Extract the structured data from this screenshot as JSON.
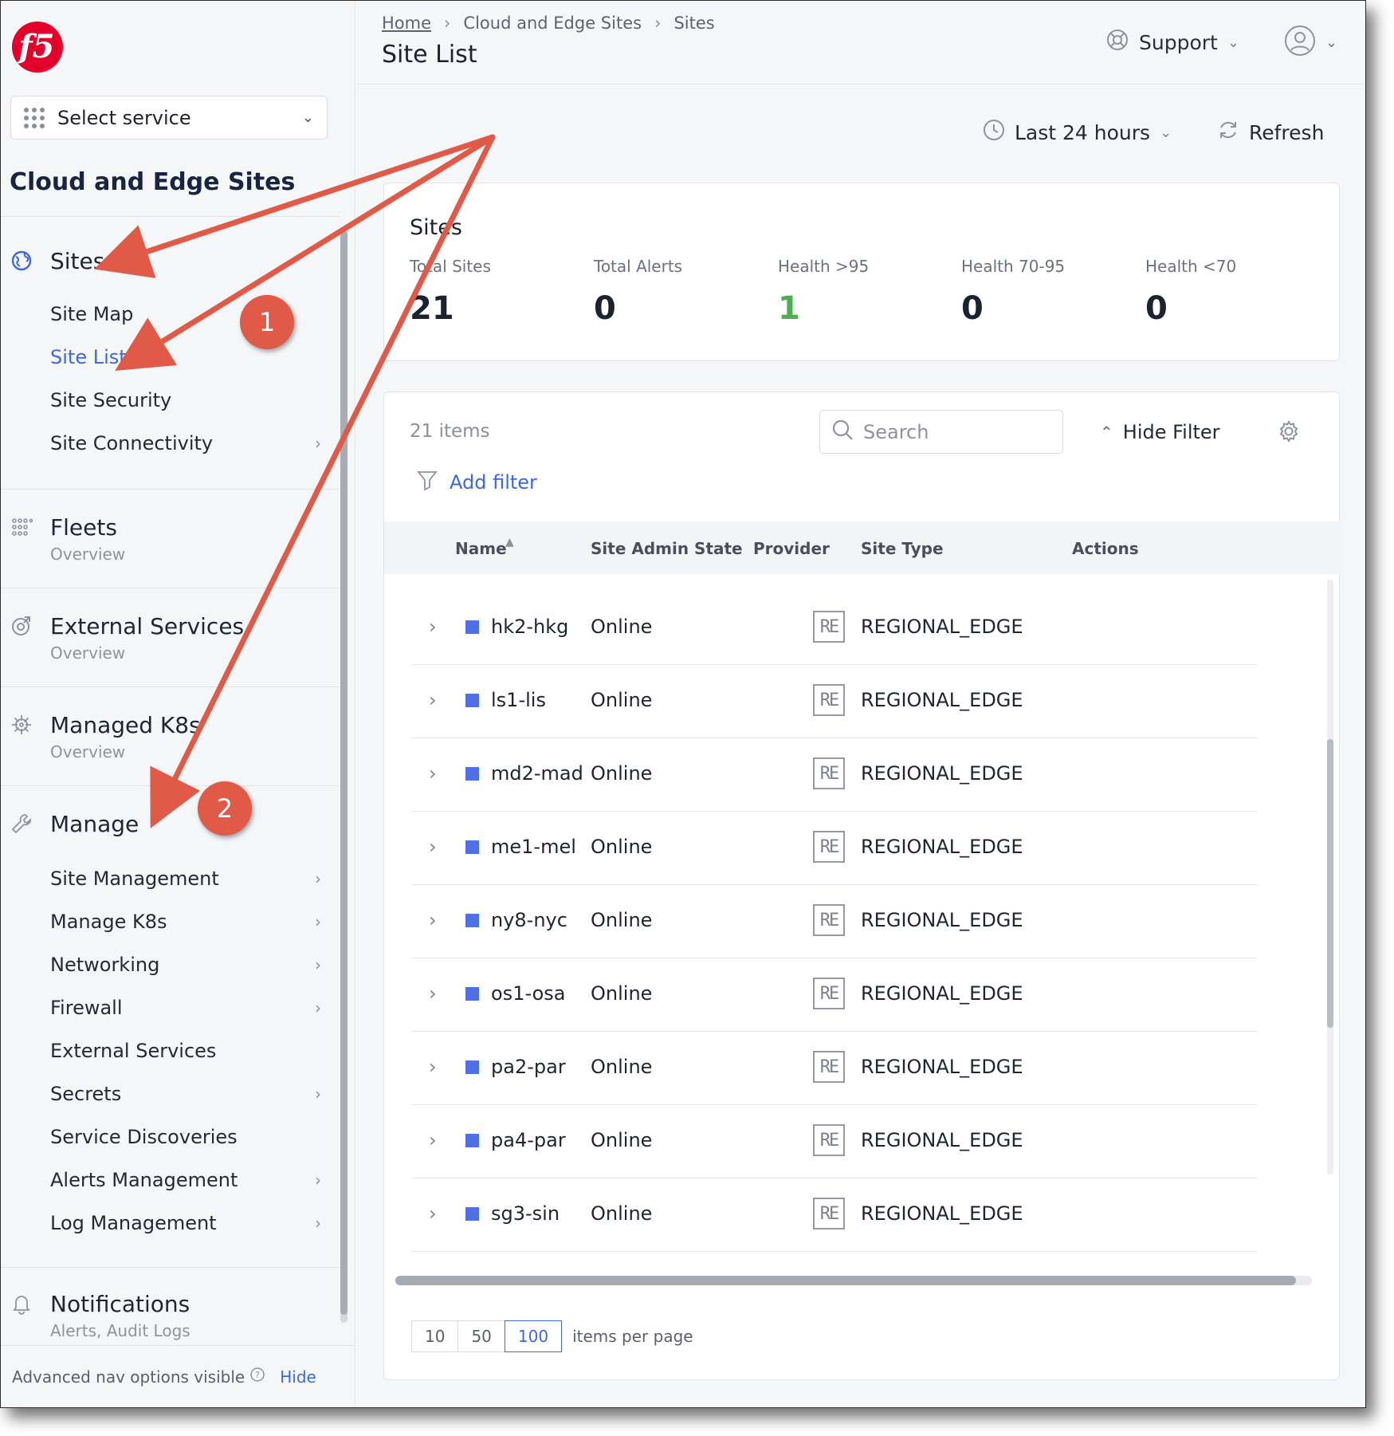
{
  "sidebar": {
    "select_service": "Select service",
    "title": "Cloud and Edge Sites",
    "sites_label": "Sites",
    "sites_items": [
      "Site Map",
      "Site List",
      "Site Security",
      "Site Connectivity"
    ],
    "fleets": {
      "title": "Fleets",
      "sub": "Overview"
    },
    "external": {
      "title": "External Services",
      "sub": "Overview"
    },
    "k8s": {
      "title": "Managed K8s",
      "sub": "Overview"
    },
    "manage_label": "Manage",
    "manage_items": [
      "Site Management",
      "Manage K8s",
      "Networking",
      "Firewall",
      "External Services",
      "Secrets",
      "Service Discoveries",
      "Alerts Management",
      "Log Management"
    ],
    "notifications": {
      "title": "Notifications",
      "sub": "Alerts, Audit Logs"
    },
    "advanced": "Advanced nav options visible",
    "hide": "Hide"
  },
  "header": {
    "breadcrumb": [
      "Home",
      "Cloud and Edge Sites",
      "Sites"
    ],
    "title": "Site List",
    "support": "Support",
    "time_range": "Last 24 hours",
    "refresh": "Refresh"
  },
  "stats": {
    "heading": "Sites",
    "items": [
      {
        "label": "Total Sites",
        "value": "21"
      },
      {
        "label": "Total Alerts",
        "value": "0"
      },
      {
        "label": "Health >95",
        "value": "1"
      },
      {
        "label": "Health 70-95",
        "value": "0"
      },
      {
        "label": "Health <70",
        "value": "0"
      }
    ]
  },
  "table": {
    "count": "21 items",
    "search_placeholder": "Search",
    "hide_filter": "Hide Filter",
    "add_filter": "Add filter",
    "columns": [
      "Name",
      "Site Admin State",
      "Provider",
      "Site Type",
      "Actions"
    ],
    "rows": [
      {
        "name": "hk2-hkg",
        "state": "Online",
        "provider": "RE",
        "type": "REGIONAL_EDGE"
      },
      {
        "name": "ls1-lis",
        "state": "Online",
        "provider": "RE",
        "type": "REGIONAL_EDGE"
      },
      {
        "name": "md2-mad",
        "state": "Online",
        "provider": "RE",
        "type": "REGIONAL_EDGE"
      },
      {
        "name": "me1-mel",
        "state": "Online",
        "provider": "RE",
        "type": "REGIONAL_EDGE"
      },
      {
        "name": "ny8-nyc",
        "state": "Online",
        "provider": "RE",
        "type": "REGIONAL_EDGE"
      },
      {
        "name": "os1-osa",
        "state": "Online",
        "provider": "RE",
        "type": "REGIONAL_EDGE"
      },
      {
        "name": "pa2-par",
        "state": "Online",
        "provider": "RE",
        "type": "REGIONAL_EDGE"
      },
      {
        "name": "pa4-par",
        "state": "Online",
        "provider": "RE",
        "type": "REGIONAL_EDGE"
      },
      {
        "name": "sg3-sin",
        "state": "Online",
        "provider": "RE",
        "type": "REGIONAL_EDGE"
      }
    ],
    "page_sizes": [
      "10",
      "50",
      "100"
    ],
    "selected_page_size": "100",
    "per_page_label": "items per page"
  },
  "annotations": {
    "badge_1": "1",
    "badge_2": "2"
  },
  "colors": {
    "accent": "#3e67e0",
    "brand": "#e4002b",
    "annotation": "#e05a47",
    "health_good": "#4caf50"
  }
}
